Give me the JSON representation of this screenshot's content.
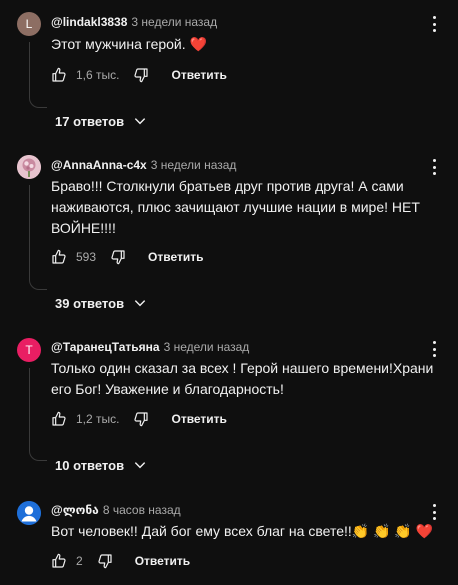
{
  "comments": [
    {
      "avatar_letter": "L",
      "avatar_color": "#8d6e63",
      "author": "@lindakl3838",
      "time": "3 недели назад",
      "text": "Этот мужчина герой. ❤️",
      "likes": "1,6 тыс.",
      "reply_label": "Ответить",
      "replies_label": "17 ответов"
    },
    {
      "avatar_letter": "",
      "avatar_color": "#d9a6b5",
      "author": "@AnnaAnna-c4x",
      "time": "3 недели назад",
      "text": "Браво!!! Столкнули братьев друг против друга! А сами наживаются, плюс зачищают лучшие нации в мире! НЕТ ВОЙНЕ!!!!",
      "likes": "593",
      "reply_label": "Ответить",
      "replies_label": "39 ответов"
    },
    {
      "avatar_letter": "T",
      "avatar_color": "#e91e63",
      "author": "@ТаранецТатьяна",
      "time": "3 недели назад",
      "text": "Только  один сказал за всех ! Герой нашего времени!Храни его Бог! Уважение и  благодарность!",
      "likes": "1,2 тыс.",
      "reply_label": "Ответить",
      "replies_label": "10 ответов"
    },
    {
      "avatar_letter": "",
      "avatar_color": "#1e6fd9",
      "author": "@ლონა",
      "time": "8 часов назад",
      "text": "Вот человек!!  Дай бог ему всех благ на свете!!👏 👏 👏 ❤️",
      "likes": "2",
      "reply_label": "Ответить"
    }
  ],
  "icons": {
    "like": "thumbs-up-icon",
    "dislike": "thumbs-down-icon",
    "more": "more-vert-icon",
    "expand": "chevron-down-icon",
    "avatar_user": "user-icon"
  }
}
